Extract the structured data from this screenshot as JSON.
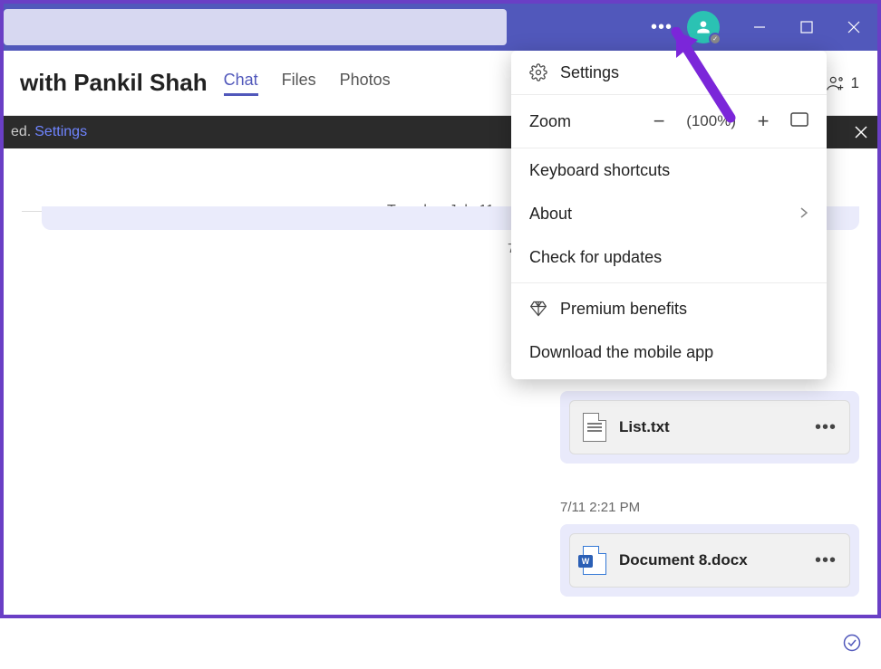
{
  "titlebar": {
    "dots": "•••"
  },
  "header": {
    "title": "with Pankil Shah",
    "tabs": {
      "chat": "Chat",
      "files": "Files",
      "photos": "Photos"
    },
    "participant_count": "1"
  },
  "notice": {
    "prefix": "ed.",
    "link": "Settings"
  },
  "date_separator": "Tuesday, July 11",
  "messages": [
    {
      "time_prefix": "7",
      "file": "List.txt",
      "icon": "txt"
    },
    {
      "time": "7/11 2:21 PM",
      "file": "Document 8.docx",
      "icon": "doc"
    }
  ],
  "menu": {
    "settings": "Settings",
    "zoom_label": "Zoom",
    "zoom_value": "(100%)",
    "keyboard": "Keyboard shortcuts",
    "about": "About",
    "updates": "Check for updates",
    "premium": "Premium benefits",
    "mobile": "Download the mobile app"
  },
  "colors": {
    "accent": "#5158bb",
    "highlight": "#7b26d9",
    "avatar": "#2bc2b3"
  }
}
